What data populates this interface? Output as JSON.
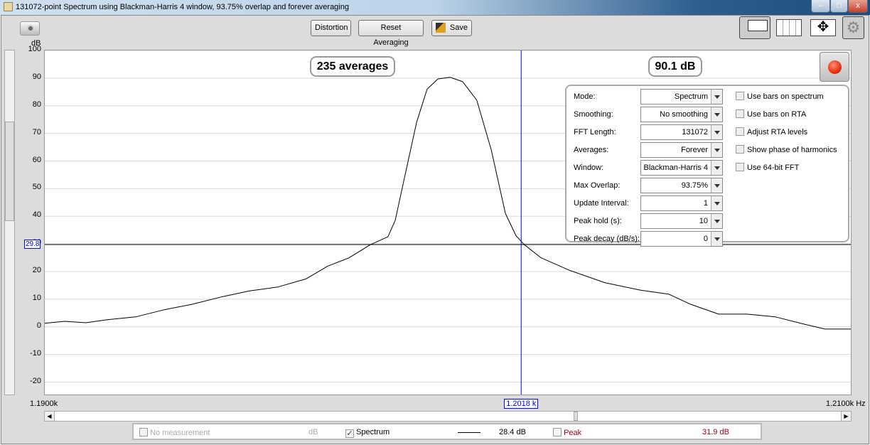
{
  "window": {
    "title": "131072-point Spectrum using Blackman-Harris 4 window, 93.75% overlap and forever averaging",
    "minimize": "–",
    "maximize": "□",
    "close": "x"
  },
  "toolbar": {
    "distortion": "Distortion",
    "reset": "Reset Averaging",
    "save": "Save",
    "icons": [
      "camera-icon",
      "graph-layout-icon",
      "grid-icon",
      "pan-zoom-icon",
      "gear-icon"
    ]
  },
  "badges": {
    "averages": "235 averages",
    "peak": "90.1 dB"
  },
  "record_button_color": "#e83010",
  "settings": {
    "rows": [
      {
        "label": "Mode:",
        "value": "Spectrum"
      },
      {
        "label": "Smoothing:",
        "value": "No  smoothing"
      },
      {
        "label": "FFT Length:",
        "value": "131072"
      },
      {
        "label": "Averages:",
        "value": "Forever"
      },
      {
        "label": "Window:",
        "value": "Blackman-Harris 4"
      },
      {
        "label": "Max Overlap:",
        "value": "93.75%"
      },
      {
        "label": "Update Interval:",
        "value": "1"
      },
      {
        "label": "Peak hold (s):",
        "value": "10"
      },
      {
        "label": "Peak decay (dB/s):",
        "value": "0"
      }
    ],
    "checks": [
      {
        "label": "Use bars on spectrum",
        "checked": false
      },
      {
        "label": "Use bars on RTA",
        "checked": false
      },
      {
        "label": "Adjust RTA levels",
        "checked": false
      },
      {
        "label": "Show phase of harmonics",
        "checked": false
      },
      {
        "label": "Use 64-bit FFT",
        "checked": false
      }
    ]
  },
  "chart_data": {
    "type": "line",
    "ylabel": "dB",
    "ylim": [
      -25,
      100
    ],
    "yticks": [
      "100",
      "90",
      "80",
      "70",
      "60",
      "50",
      "40",
      "30",
      "20",
      "10",
      "0",
      "-10",
      "-20"
    ],
    "xlim_hz": [
      1190,
      1210
    ],
    "x_start_label": "1.1900k",
    "x_end_label": "1.2100k Hz",
    "grid": true,
    "cursor": {
      "x_label": "1.2018 k",
      "y_label": "29.8",
      "x_hz": 1201.8,
      "y_db": 29.8
    },
    "series": [
      {
        "color": "#000000",
        "x": [
          1190.0,
          1190.49,
          1191.02,
          1191.55,
          1192.25,
          1192.96,
          1193.66,
          1194.37,
          1195.07,
          1195.77,
          1196.48,
          1197.01,
          1197.54,
          1198.06,
          1198.5,
          1198.68,
          1198.94,
          1199.21,
          1199.47,
          1199.74,
          1200.04,
          1200.35,
          1200.7,
          1201.06,
          1201.41,
          1201.67,
          1201.88,
          1202.29,
          1202.99,
          1203.87,
          1204.75,
          1205.46,
          1205.99,
          1206.69,
          1207.39,
          1208.1,
          1208.8,
          1209.33,
          1210.0
        ],
        "y": [
          1.3,
          2.0,
          1.5,
          2.6,
          3.6,
          6.2,
          8.2,
          10.8,
          13.0,
          14.4,
          17.4,
          22.0,
          25.0,
          29.7,
          32.6,
          38.5,
          56,
          74,
          86,
          89.7,
          90.3,
          88.7,
          82,
          64,
          41,
          33,
          29.7,
          25.0,
          20.5,
          16.0,
          13.3,
          11.8,
          8.2,
          4.6,
          4.6,
          3.6,
          1.0,
          -0.8,
          -0.8
        ]
      }
    ]
  },
  "legend": {
    "no_measurement": "No measurement",
    "no_measurement_unit": "dB",
    "spectrum": "Spectrum",
    "spectrum_value": "28.4 dB",
    "peak": "Peak",
    "peak_value": "31.9 dB",
    "peak_color": "#a00020"
  }
}
